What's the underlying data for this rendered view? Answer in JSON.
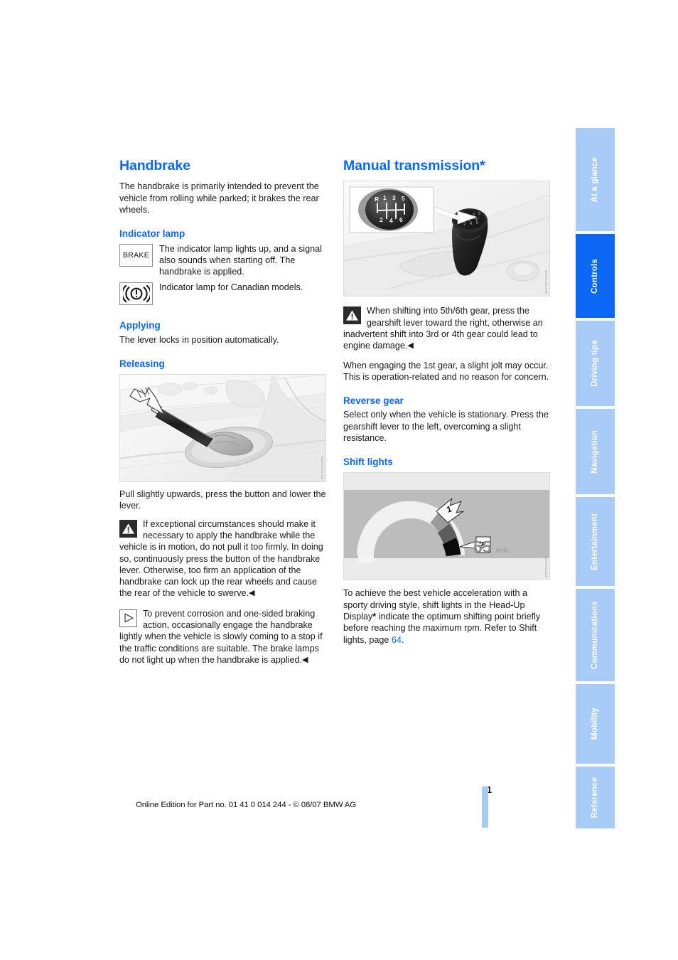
{
  "document": {
    "page_number": "61",
    "footer_line": "Online Edition for Part no. 01 41 0 014 244 - © 08/07 BMW AG"
  },
  "colors": {
    "accent_blue": "#0a68f5",
    "tab_inactive": "#a8ccf7",
    "tab_active": "#0a68f5",
    "text": "#1a1a1a"
  },
  "sidebar": {
    "tabs": [
      {
        "label": "At a glance",
        "active": false
      },
      {
        "label": "Controls",
        "active": true
      },
      {
        "label": "Driving tips",
        "active": false
      },
      {
        "label": "Navigation",
        "active": false
      },
      {
        "label": "Entertainment",
        "active": false
      },
      {
        "label": "Communications",
        "active": false
      },
      {
        "label": "Mobility",
        "active": false
      },
      {
        "label": "Reference",
        "active": false
      }
    ]
  },
  "left_column": {
    "title": "Handbrake",
    "intro": "The handbrake is primarily intended to prevent the vehicle from rolling while parked; it brakes the rear wheels.",
    "indicator_lamp": {
      "heading": "Indicator lamp",
      "rows": [
        {
          "icon_label": "BRAKE",
          "icon_name": "brake-indicator-icon",
          "text": "The indicator lamp lights up, and a signal also sounds when starting off. The handbrake is applied."
        },
        {
          "icon_label": "((!))",
          "icon_name": "canadian-brake-indicator-icon",
          "text": "Indicator lamp for Canadian models."
        }
      ]
    },
    "applying": {
      "heading": "Applying",
      "text": "The lever locks in position automatically."
    },
    "releasing": {
      "heading": "Releasing",
      "figure_caption": "Pull slightly upwards, press the button and lower the lever.",
      "figure_credit": "WS7CN1AP0A",
      "figure_alt": "Handbrake lever with arrow pointing at release button"
    },
    "warning_note": {
      "icon": "warning-triangle",
      "text": "If exceptional circumstances should make it necessary to apply the handbrake while the vehicle is in motion, do not pull it too firmly. In doing so, continuously press the button of the handbrake lever. Otherwise, too firm an application of the handbrake can lock up the rear wheels and cause the rear of the vehicle to swerve.",
      "end_mark": "◀"
    },
    "tip_note": {
      "icon": "note-triangle",
      "text": "To prevent corrosion and one-sided braking action, occasionally engage the handbrake lightly when the vehicle is slowly coming to a stop if the traffic conditions are suitable. The brake lamps do not light up when the handbrake is applied.",
      "end_mark": "◀"
    }
  },
  "right_column": {
    "title": "Manual transmission*",
    "figure_transmission": {
      "credit": "WS7CN1AP0B",
      "alt": "Gearshift lever with inset of shift pattern",
      "shift_pattern_top": [
        "R",
        "1",
        "3",
        "5"
      ],
      "shift_pattern_bottom": [
        "2",
        "4",
        "6"
      ]
    },
    "warning_note": {
      "icon": "warning-triangle",
      "text": "When shifting into 5th/6th gear, press the gearshift lever toward the right, otherwise an inadvertent shift into 3rd or 4th gear could lead to engine damage.",
      "end_mark": "◀"
    },
    "paragraph_jolt": "When engaging the 1st gear, a slight jolt may occur. This is operation-related and no reason for concern.",
    "reverse_gear": {
      "heading": "Reverse gear",
      "text": "Select only when the vehicle is stationary. Press the gearshift lever to the left, overcoming a slight resistance."
    },
    "shift_lights": {
      "heading": "Shift lights",
      "figure": {
        "credit": "WS7CN1AP0C",
        "alt": "Head-Up Display tachometer arc with shift light segments",
        "speed_value": "55",
        "speed_unit": "mph",
        "callouts": [
          "1",
          "2"
        ]
      },
      "text_part1": "To achieve the best vehicle acceleration with a sporty driving style, shift lights in the Head-Up Display",
      "text_star": "*",
      "text_part2": " indicate the optimum shifting point briefly before reaching the maximum rpm. Refer to Shift lights, page ",
      "page_link": "64",
      "text_end": "."
    }
  }
}
